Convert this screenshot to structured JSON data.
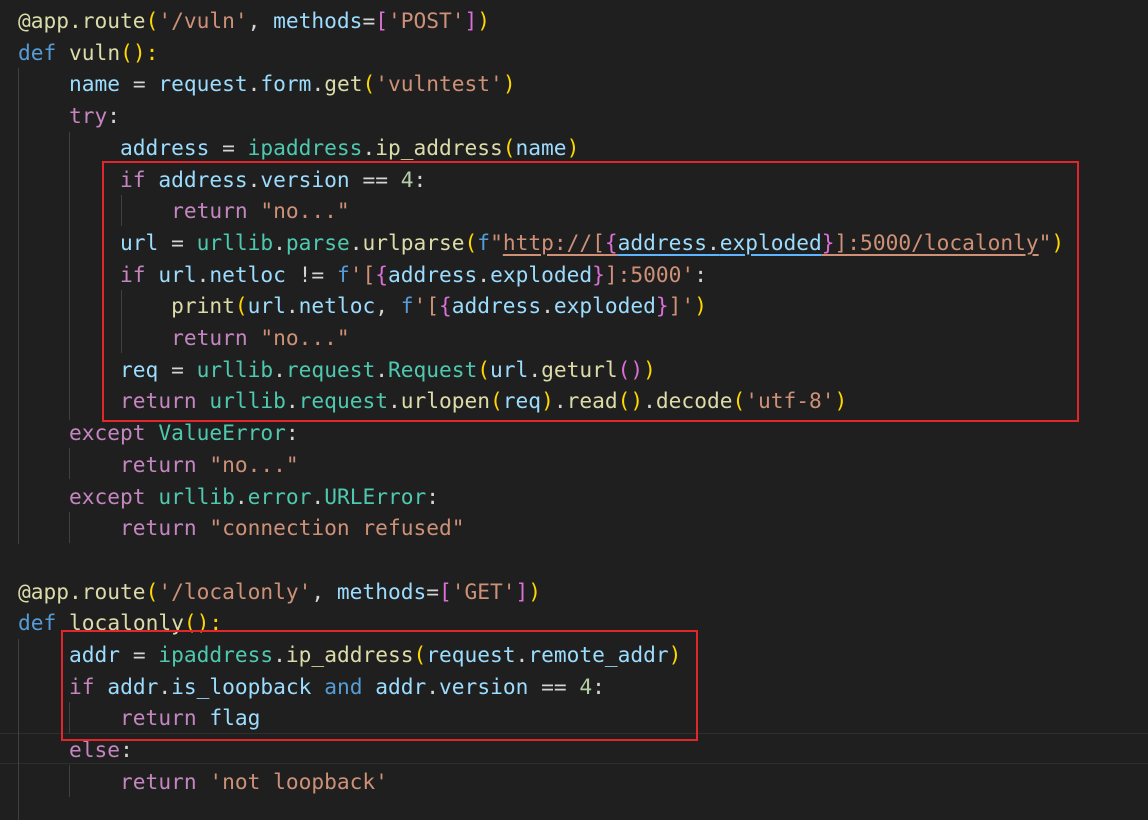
{
  "editor": {
    "language": "python",
    "colors": {
      "background": "#1f1f1f",
      "default": "#d4d4d4",
      "decorator": "#dcdcaa",
      "function": "#dcdcaa",
      "keyword": "#569cd6",
      "control": "#c586c0",
      "variable": "#9cdcfe",
      "string": "#ce9178",
      "number": "#b5cea8",
      "class": "#4ec9b0",
      "bracket1": "#ffd700",
      "bracket2": "#da70d6",
      "bracket3": "#179fff",
      "highlight_box": "#e2262b"
    },
    "lines": [
      {
        "tokens": [
          {
            "t": "@app.route",
            "c": "decorator"
          },
          {
            "t": "(",
            "c": "bracket1"
          },
          {
            "t": "'/vuln'",
            "c": "string"
          },
          {
            "t": ", ",
            "c": "default"
          },
          {
            "t": "methods",
            "c": "variable"
          },
          {
            "t": "=",
            "c": "default"
          },
          {
            "t": "[",
            "c": "bracket2"
          },
          {
            "t": "'POST'",
            "c": "string"
          },
          {
            "t": "]",
            "c": "bracket2"
          },
          {
            "t": ")",
            "c": "bracket1"
          }
        ]
      },
      {
        "tokens": [
          {
            "t": "def",
            "c": "keyword"
          },
          {
            "t": " ",
            "c": "default"
          },
          {
            "t": "vuln",
            "c": "function"
          },
          {
            "t": "():",
            "c": "bracket1"
          }
        ]
      },
      {
        "tokens": [
          {
            "t": "    name",
            "c": "variable"
          },
          {
            "t": " = ",
            "c": "default"
          },
          {
            "t": "request",
            "c": "variable"
          },
          {
            "t": ".",
            "c": "default"
          },
          {
            "t": "form",
            "c": "variable"
          },
          {
            "t": ".",
            "c": "default"
          },
          {
            "t": "get",
            "c": "function"
          },
          {
            "t": "(",
            "c": "bracket1"
          },
          {
            "t": "'vulntest'",
            "c": "string"
          },
          {
            "t": ")",
            "c": "bracket1"
          }
        ]
      },
      {
        "tokens": [
          {
            "t": "    try",
            "c": "control"
          },
          {
            "t": ":",
            "c": "default"
          }
        ]
      },
      {
        "tokens": [
          {
            "t": "        address",
            "c": "variable"
          },
          {
            "t": " = ",
            "c": "default"
          },
          {
            "t": "ipaddress",
            "c": "class"
          },
          {
            "t": ".",
            "c": "default"
          },
          {
            "t": "ip_address",
            "c": "function"
          },
          {
            "t": "(",
            "c": "bracket1"
          },
          {
            "t": "name",
            "c": "variable"
          },
          {
            "t": ")",
            "c": "bracket1"
          }
        ]
      },
      {
        "tokens": [
          {
            "t": "        if",
            "c": "control"
          },
          {
            "t": " ",
            "c": "default"
          },
          {
            "t": "address",
            "c": "variable"
          },
          {
            "t": ".",
            "c": "default"
          },
          {
            "t": "version",
            "c": "variable"
          },
          {
            "t": " == ",
            "c": "default"
          },
          {
            "t": "4",
            "c": "number"
          },
          {
            "t": ":",
            "c": "default"
          }
        ]
      },
      {
        "tokens": [
          {
            "t": "            return",
            "c": "control"
          },
          {
            "t": " ",
            "c": "default"
          },
          {
            "t": "\"no...\"",
            "c": "string"
          }
        ]
      },
      {
        "tokens": [
          {
            "t": "        url",
            "c": "variable"
          },
          {
            "t": " = ",
            "c": "default"
          },
          {
            "t": "urllib",
            "c": "class"
          },
          {
            "t": ".",
            "c": "default"
          },
          {
            "t": "parse",
            "c": "class"
          },
          {
            "t": ".",
            "c": "default"
          },
          {
            "t": "urlparse",
            "c": "function"
          },
          {
            "t": "(",
            "c": "bracket1"
          },
          {
            "t": "f",
            "c": "keyword"
          },
          {
            "t": "\"",
            "c": "string"
          },
          {
            "t": "http://[",
            "c": "string",
            "u": "uo"
          },
          {
            "t": "{",
            "c": "bracket2",
            "u": "uo"
          },
          {
            "t": "address",
            "c": "variable",
            "u": "u"
          },
          {
            "t": ".",
            "c": "default",
            "u": "u"
          },
          {
            "t": "exploded",
            "c": "variable",
            "u": "u"
          },
          {
            "t": "}",
            "c": "bracket2",
            "u": "uo"
          },
          {
            "t": "]:5000/localonly",
            "c": "string",
            "u": "uo"
          },
          {
            "t": "\"",
            "c": "string"
          },
          {
            "t": ")",
            "c": "bracket1"
          }
        ]
      },
      {
        "tokens": [
          {
            "t": "        if",
            "c": "control"
          },
          {
            "t": " ",
            "c": "default"
          },
          {
            "t": "url",
            "c": "variable"
          },
          {
            "t": ".",
            "c": "default"
          },
          {
            "t": "netloc",
            "c": "variable"
          },
          {
            "t": " != ",
            "c": "default"
          },
          {
            "t": "f",
            "c": "keyword"
          },
          {
            "t": "'[",
            "c": "string"
          },
          {
            "t": "{",
            "c": "bracket2"
          },
          {
            "t": "address",
            "c": "variable"
          },
          {
            "t": ".",
            "c": "default"
          },
          {
            "t": "exploded",
            "c": "variable"
          },
          {
            "t": "}",
            "c": "bracket2"
          },
          {
            "t": "]:5000'",
            "c": "string"
          },
          {
            "t": ":",
            "c": "default"
          }
        ]
      },
      {
        "tokens": [
          {
            "t": "            print",
            "c": "function"
          },
          {
            "t": "(",
            "c": "bracket1"
          },
          {
            "t": "url",
            "c": "variable"
          },
          {
            "t": ".",
            "c": "default"
          },
          {
            "t": "netloc",
            "c": "variable"
          },
          {
            "t": ", ",
            "c": "default"
          },
          {
            "t": "f",
            "c": "keyword"
          },
          {
            "t": "'[",
            "c": "string"
          },
          {
            "t": "{",
            "c": "bracket2"
          },
          {
            "t": "address",
            "c": "variable"
          },
          {
            "t": ".",
            "c": "default"
          },
          {
            "t": "exploded",
            "c": "variable"
          },
          {
            "t": "}",
            "c": "bracket2"
          },
          {
            "t": "]'",
            "c": "string"
          },
          {
            "t": ")",
            "c": "bracket1"
          }
        ]
      },
      {
        "tokens": [
          {
            "t": "            return",
            "c": "control"
          },
          {
            "t": " ",
            "c": "default"
          },
          {
            "t": "\"no...\"",
            "c": "string"
          }
        ]
      },
      {
        "tokens": [
          {
            "t": "        req",
            "c": "variable"
          },
          {
            "t": " = ",
            "c": "default"
          },
          {
            "t": "urllib",
            "c": "class"
          },
          {
            "t": ".",
            "c": "default"
          },
          {
            "t": "request",
            "c": "class"
          },
          {
            "t": ".",
            "c": "default"
          },
          {
            "t": "Request",
            "c": "class"
          },
          {
            "t": "(",
            "c": "bracket1"
          },
          {
            "t": "url",
            "c": "variable"
          },
          {
            "t": ".",
            "c": "default"
          },
          {
            "t": "geturl",
            "c": "function"
          },
          {
            "t": "()",
            "c": "bracket2"
          },
          {
            "t": ")",
            "c": "bracket1"
          }
        ]
      },
      {
        "tokens": [
          {
            "t": "        return",
            "c": "control"
          },
          {
            "t": " ",
            "c": "default"
          },
          {
            "t": "urllib",
            "c": "class"
          },
          {
            "t": ".",
            "c": "default"
          },
          {
            "t": "request",
            "c": "class"
          },
          {
            "t": ".",
            "c": "default"
          },
          {
            "t": "urlopen",
            "c": "function"
          },
          {
            "t": "(",
            "c": "bracket1"
          },
          {
            "t": "req",
            "c": "variable"
          },
          {
            "t": ")",
            "c": "bracket1"
          },
          {
            "t": ".",
            "c": "default"
          },
          {
            "t": "read",
            "c": "function"
          },
          {
            "t": "()",
            "c": "bracket1"
          },
          {
            "t": ".",
            "c": "default"
          },
          {
            "t": "decode",
            "c": "function"
          },
          {
            "t": "(",
            "c": "bracket1"
          },
          {
            "t": "'utf-8'",
            "c": "string"
          },
          {
            "t": ")",
            "c": "bracket1"
          }
        ]
      },
      {
        "tokens": [
          {
            "t": "    except",
            "c": "control"
          },
          {
            "t": " ",
            "c": "default"
          },
          {
            "t": "ValueError",
            "c": "class"
          },
          {
            "t": ":",
            "c": "default"
          }
        ]
      },
      {
        "tokens": [
          {
            "t": "        return",
            "c": "control"
          },
          {
            "t": " ",
            "c": "default"
          },
          {
            "t": "\"no...\"",
            "c": "string"
          }
        ]
      },
      {
        "tokens": [
          {
            "t": "    except",
            "c": "control"
          },
          {
            "t": " ",
            "c": "default"
          },
          {
            "t": "urllib",
            "c": "class"
          },
          {
            "t": ".",
            "c": "default"
          },
          {
            "t": "error",
            "c": "class"
          },
          {
            "t": ".",
            "c": "default"
          },
          {
            "t": "URLError",
            "c": "class"
          },
          {
            "t": ":",
            "c": "default"
          }
        ]
      },
      {
        "tokens": [
          {
            "t": "        return",
            "c": "control"
          },
          {
            "t": " ",
            "c": "default"
          },
          {
            "t": "\"connection refused\"",
            "c": "string"
          }
        ]
      },
      {
        "tokens": []
      },
      {
        "tokens": [
          {
            "t": "@app.route",
            "c": "decorator"
          },
          {
            "t": "(",
            "c": "bracket1"
          },
          {
            "t": "'/localonly'",
            "c": "string"
          },
          {
            "t": ", ",
            "c": "default"
          },
          {
            "t": "methods",
            "c": "variable"
          },
          {
            "t": "=",
            "c": "default"
          },
          {
            "t": "[",
            "c": "bracket2"
          },
          {
            "t": "'GET'",
            "c": "string"
          },
          {
            "t": "]",
            "c": "bracket2"
          },
          {
            "t": ")",
            "c": "bracket1"
          }
        ]
      },
      {
        "tokens": [
          {
            "t": "def",
            "c": "keyword"
          },
          {
            "t": " ",
            "c": "default"
          },
          {
            "t": "localonly",
            "c": "function"
          },
          {
            "t": "():",
            "c": "bracket1"
          }
        ]
      },
      {
        "tokens": [
          {
            "t": "    addr",
            "c": "variable"
          },
          {
            "t": " = ",
            "c": "default"
          },
          {
            "t": "ipaddress",
            "c": "class"
          },
          {
            "t": ".",
            "c": "default"
          },
          {
            "t": "ip_address",
            "c": "function"
          },
          {
            "t": "(",
            "c": "bracket1"
          },
          {
            "t": "request",
            "c": "variable"
          },
          {
            "t": ".",
            "c": "default"
          },
          {
            "t": "remote_addr",
            "c": "variable"
          },
          {
            "t": ")",
            "c": "bracket1"
          }
        ]
      },
      {
        "tokens": [
          {
            "t": "    if",
            "c": "control"
          },
          {
            "t": " ",
            "c": "default"
          },
          {
            "t": "addr",
            "c": "variable"
          },
          {
            "t": ".",
            "c": "default"
          },
          {
            "t": "is_loopback",
            "c": "variable"
          },
          {
            "t": " ",
            "c": "default"
          },
          {
            "t": "and",
            "c": "keyword"
          },
          {
            "t": " ",
            "c": "default"
          },
          {
            "t": "addr",
            "c": "variable"
          },
          {
            "t": ".",
            "c": "default"
          },
          {
            "t": "version",
            "c": "variable"
          },
          {
            "t": " == ",
            "c": "default"
          },
          {
            "t": "4",
            "c": "number"
          },
          {
            "t": ":",
            "c": "default"
          }
        ]
      },
      {
        "tokens": [
          {
            "t": "        return",
            "c": "control"
          },
          {
            "t": " ",
            "c": "default"
          },
          {
            "t": "flag",
            "c": "variable"
          }
        ]
      },
      {
        "tokens": [
          {
            "t": "    else",
            "c": "control"
          },
          {
            "t": ":",
            "c": "default"
          }
        ]
      },
      {
        "tokens": [
          {
            "t": "        return",
            "c": "control"
          },
          {
            "t": " ",
            "c": "default"
          },
          {
            "t": "'not loopback'",
            "c": "string"
          }
        ]
      }
    ]
  }
}
